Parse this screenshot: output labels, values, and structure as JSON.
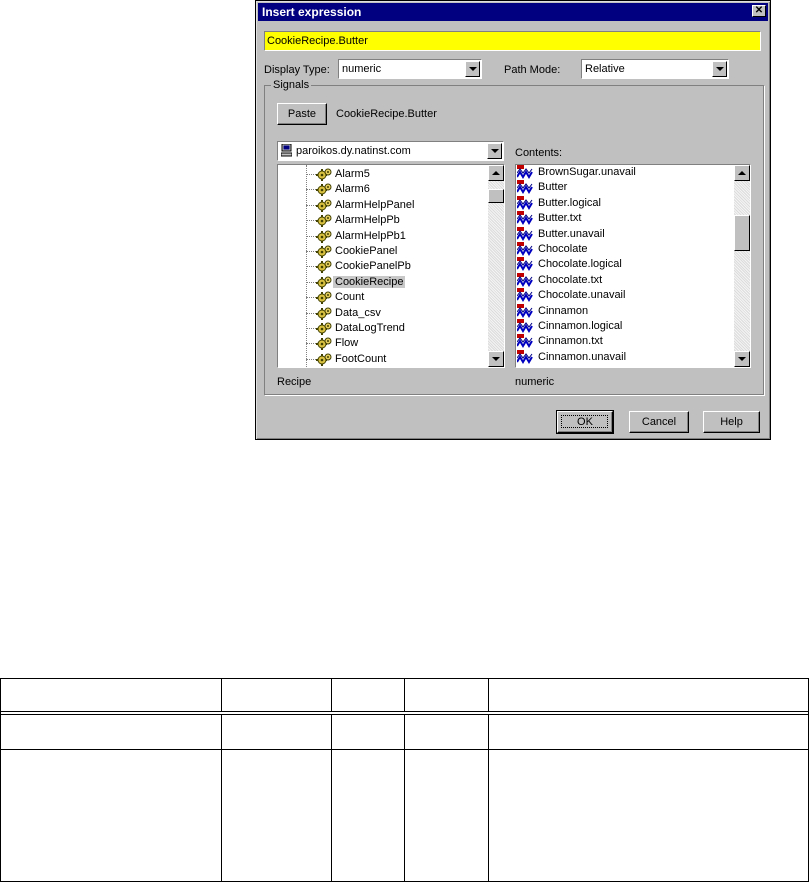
{
  "dialog": {
    "title": "Insert expression",
    "close_symbol": "✕",
    "expression": "CookieRecipe.Butter",
    "display_type_label": "Display Type:",
    "display_type_value": "numeric",
    "path_mode_label": "Path Mode:",
    "path_mode_value": "Relative",
    "signals_label": "Signals",
    "paste_label": "Paste",
    "paste_text": "CookieRecipe.Butter",
    "computer": "paroikos.dy.natinst.com",
    "contents_label": "Contents:",
    "tree_items": [
      "Alarm5",
      "Alarm6",
      "AlarmHelpPanel",
      "AlarmHelpPb",
      "AlarmHelpPb1",
      "CookiePanel",
      "CookiePanelPb",
      "CookieRecipe",
      "Count",
      "Data_csv",
      "DataLogTrend",
      "Flow",
      "FootCount"
    ],
    "tree_selected": "CookieRecipe",
    "contents_items": [
      "BrownSugar.unavail",
      "Butter",
      "Butter.logical",
      "Butter.txt",
      "Butter.unavail",
      "Chocolate",
      "Chocolate.logical",
      "Chocolate.txt",
      "Chocolate.unavail",
      "Cinnamon",
      "Cinnamon.logical",
      "Cinnamon.txt",
      "Cinnamon.unavail"
    ],
    "left_status": "Recipe",
    "right_status": "numeric",
    "ok_label": "OK",
    "cancel_label": "Cancel",
    "help_label": "Help"
  },
  "colors": {
    "titlebar": "#000080",
    "expression_bg": "#ffff00",
    "dialog_bg": "#c0c0c0"
  },
  "icons": {
    "tree_item": "gear-icon",
    "content_item": "signal-icon",
    "computer": "computer-icon"
  }
}
